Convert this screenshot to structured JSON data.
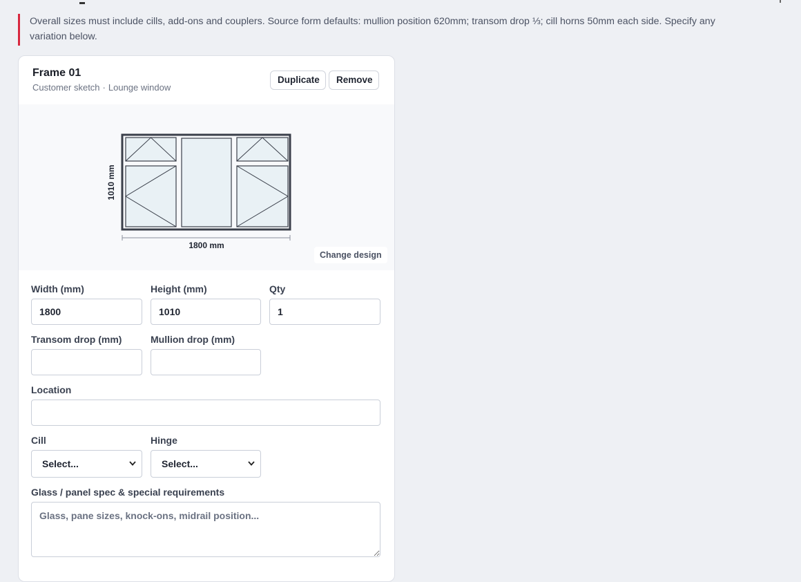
{
  "notice": {
    "text": "Overall sizes must include cills, add-ons and couplers. Source form defaults: mullion position 620mm; transom drop ⅓; cill horns 50mm each side. Specify any variation below."
  },
  "frame": {
    "title": "Frame 01",
    "source": "Customer sketch",
    "separator": "·",
    "room": "Lounge window",
    "duplicate_label": "Duplicate",
    "remove_label": "Remove",
    "sketch": {
      "height_label": "1010 mm",
      "width_label": "1800 mm",
      "change_design_label": "Change design"
    },
    "fields": {
      "width_label": "Width (mm)",
      "width_value": "1800",
      "height_label": "Height (mm)",
      "height_value": "1010",
      "qty_label": "Qty",
      "qty_value": "1",
      "transom_label": "Transom drop (mm)",
      "transom_value": "",
      "mullion_label": "Mullion drop (mm)",
      "mullion_value": "",
      "location_label": "Location",
      "location_value": "",
      "cill_label": "Cill",
      "cill_selected": "Select...",
      "hinge_label": "Hinge",
      "hinge_selected": "Select...",
      "glass_label": "Glass / panel spec & special requirements",
      "glass_placeholder": "Glass, pane sizes, knock-ons, midrail position..."
    }
  },
  "colors": {
    "accent_bar": "#d8283f",
    "glass_fill": "#e9f1f5",
    "frame_stroke": "#3a3f4a"
  }
}
